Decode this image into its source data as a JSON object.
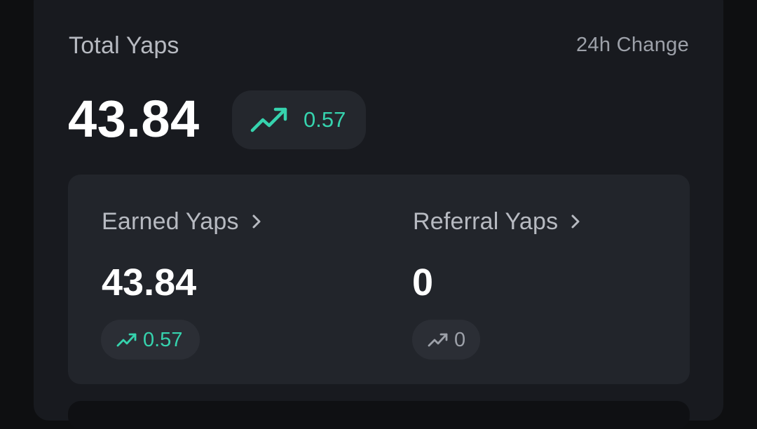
{
  "header": {
    "title": "Total Yaps",
    "change_label": "24h Change"
  },
  "total": {
    "value": "43.84",
    "change": "0.57",
    "trend_icon": "trend-up-icon",
    "change_color": "#36d3ae"
  },
  "breakdown": [
    {
      "title": "Earned Yaps",
      "value": "43.84",
      "change": "0.57",
      "trend_icon": "trend-up-icon",
      "change_color": "#36d3ae"
    },
    {
      "title": "Referral Yaps",
      "value": "0",
      "change": "0",
      "trend_icon": "trend-up-icon",
      "change_color": "#9da1a9"
    }
  ]
}
